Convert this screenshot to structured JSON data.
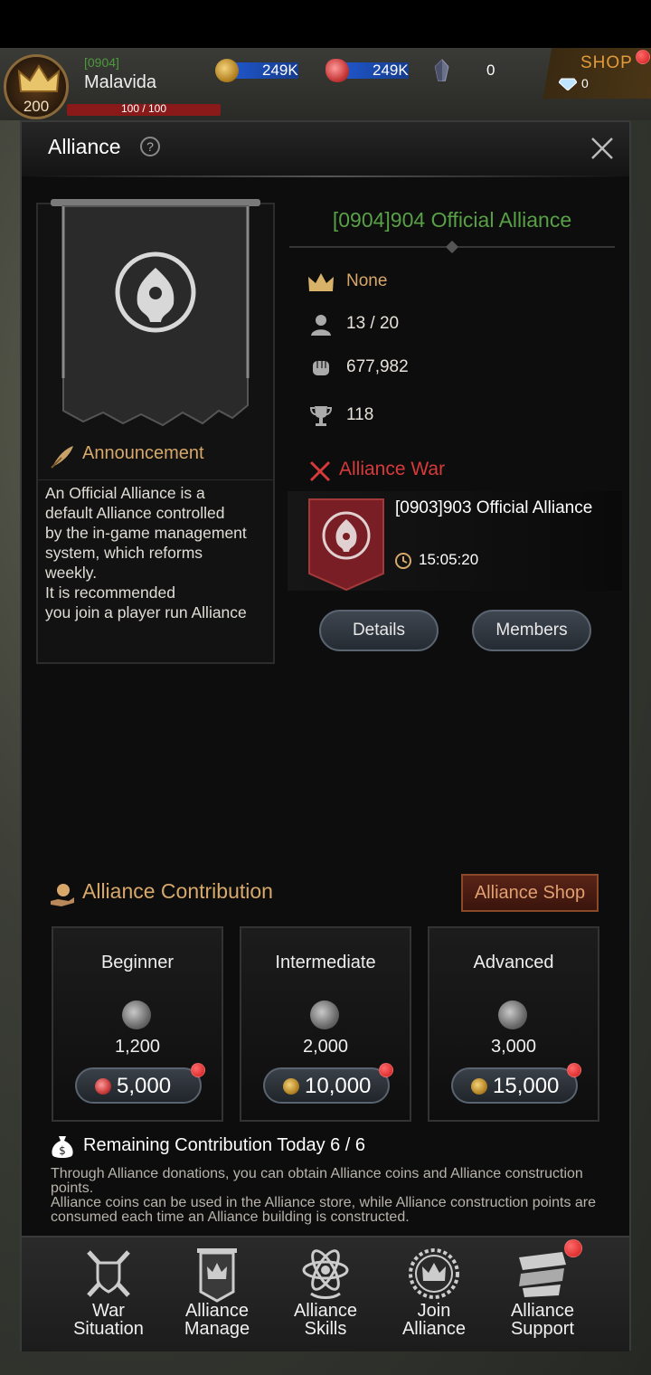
{
  "player": {
    "server_tag": "[0904]",
    "name": "Malavida",
    "level": "200",
    "hp": "100 / 100"
  },
  "resources": {
    "gold": "249K",
    "meat": "249K",
    "crystal": "0",
    "gems": "0",
    "shop_label": "SHOP"
  },
  "window": {
    "title": "Alliance",
    "help": "?"
  },
  "alliance": {
    "name": "[0904]904 Official Alliance",
    "leader": "None",
    "members": "13 / 20",
    "power": "677,982",
    "trophies": "118",
    "announcement_title": "Announcement",
    "announcement_text": "An Official Alliance is a\ndefault Alliance controlled\nby the in-game management\nsystem, which reforms\nweekly.\nIt is recommended\nyou join a player run Alliance"
  },
  "war": {
    "title": "Alliance War",
    "opponent": "[0903]903 Official Alliance",
    "timer": "15:05:20",
    "details_label": "Details",
    "members_label": "Members"
  },
  "contribution": {
    "title": "Alliance Contribution",
    "shop_label": "Alliance Shop",
    "tiers": [
      {
        "name": "Beginner",
        "reward": "1,200",
        "cost": "5,000",
        "cost_icon": "meat-icon"
      },
      {
        "name": "Intermediate",
        "reward": "2,000",
        "cost": "10,000",
        "cost_icon": "gold-coin-icon"
      },
      {
        "name": "Advanced",
        "reward": "3,000",
        "cost": "15,000",
        "cost_icon": "gold-coin-icon"
      }
    ],
    "remaining": "Remaining Contribution Today 6 / 6",
    "info": "Through Alliance donations, you can obtain Alliance coins and Alliance construction points.\nAlliance coins can be used in the Alliance store, while Alliance construction points are consumed each time an Alliance building is constructed."
  },
  "nav": [
    {
      "label": "War\nSituation",
      "icon": "crossed-axes-icon"
    },
    {
      "label": "Alliance\nManage",
      "icon": "banner-crown-icon"
    },
    {
      "label": "Alliance\nSkills",
      "icon": "atom-icon"
    },
    {
      "label": "Join\nAlliance",
      "icon": "wreath-crown-icon"
    },
    {
      "label": "Alliance\nSupport",
      "icon": "scroll-banner-icon"
    }
  ],
  "colors": {
    "alliance_name": "#58a046",
    "war_red": "#d63a3a",
    "gold_text": "#d7a86a"
  }
}
